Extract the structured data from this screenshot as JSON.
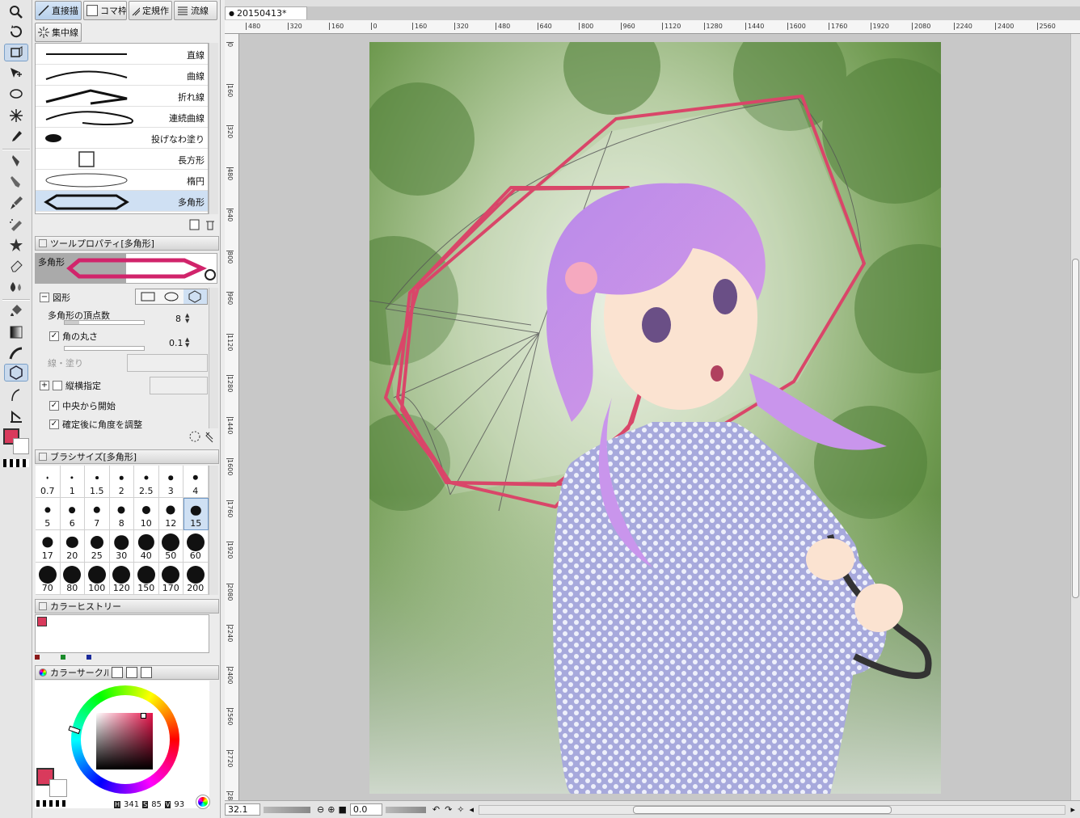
{
  "toolbar": {
    "tools": [
      "zoom-icon",
      "rotate-icon",
      "move-layer-icon",
      "object-select-icon",
      "lasso-icon",
      "magic-wand-icon",
      "eyedropper-icon",
      "pen-icon",
      "pencil-icon",
      "brush-icon",
      "airbrush-icon",
      "decoration-icon",
      "eraser-icon",
      "blend-icon",
      "fill-icon",
      "gradient-icon",
      "figure-icon",
      "shape-icon",
      "ruler-icon",
      "text-icon"
    ]
  },
  "subtool_tabs": [
    "直接描",
    "コマ枠",
    "定規作",
    "流線",
    "集中線"
  ],
  "subtools": [
    {
      "label": "直線"
    },
    {
      "label": "曲線"
    },
    {
      "label": "折れ線"
    },
    {
      "label": "連続曲線"
    },
    {
      "label": "投げなわ塗り"
    },
    {
      "label": "長方形"
    },
    {
      "label": "楕円"
    },
    {
      "label": "多角形"
    }
  ],
  "tool_property": {
    "header": "ツールプロパティ[多角形]",
    "preview_label": "多角形",
    "section": "図形",
    "vertices_label": "多角形の頂点数",
    "vertices_value": "8",
    "roundness_label": "角の丸さ",
    "roundness_value": "0.1",
    "line_fill_label": "線・塗り",
    "aspect_label": "縦横指定",
    "center_label": "中央から開始",
    "adjust_angle_label": "確定後に角度を調整"
  },
  "brush_size": {
    "header": "ブラシサイズ[多角形]",
    "sizes": [
      "0.7",
      "1",
      "1.5",
      "2",
      "2.5",
      "3",
      "4",
      "5",
      "6",
      "7",
      "8",
      "10",
      "12",
      "15",
      "17",
      "20",
      "25",
      "30",
      "40",
      "50",
      "60",
      "70",
      "80",
      "100",
      "120",
      "150",
      "170",
      "200"
    ],
    "selected": "15"
  },
  "color_history": {
    "header": "カラーヒストリー"
  },
  "color_circle": {
    "header": "カラーサークル",
    "h": "341",
    "s": "85",
    "v": "93"
  },
  "colors": {
    "main": "#d93a5c",
    "accent_dark_red": "#8b1a1a",
    "accent_green": "#1a8b2a",
    "accent_blue": "#1a2a9b"
  },
  "document": {
    "tab": "20150413*"
  },
  "ruler_h": [
    "480",
    "320",
    "160",
    "0",
    "160",
    "320",
    "480",
    "640",
    "800",
    "960",
    "1120",
    "1280",
    "1440",
    "1600",
    "1760",
    "1920",
    "2080",
    "2240",
    "2400",
    "2560"
  ],
  "ruler_v": [
    "0",
    "160",
    "320",
    "480",
    "640",
    "800",
    "960",
    "1120",
    "1280",
    "1440",
    "1600",
    "1760",
    "1920",
    "2080",
    "2240",
    "2400",
    "2560",
    "2720",
    "2880"
  ],
  "status": {
    "zoom": "32.1",
    "angle": "0.0"
  }
}
